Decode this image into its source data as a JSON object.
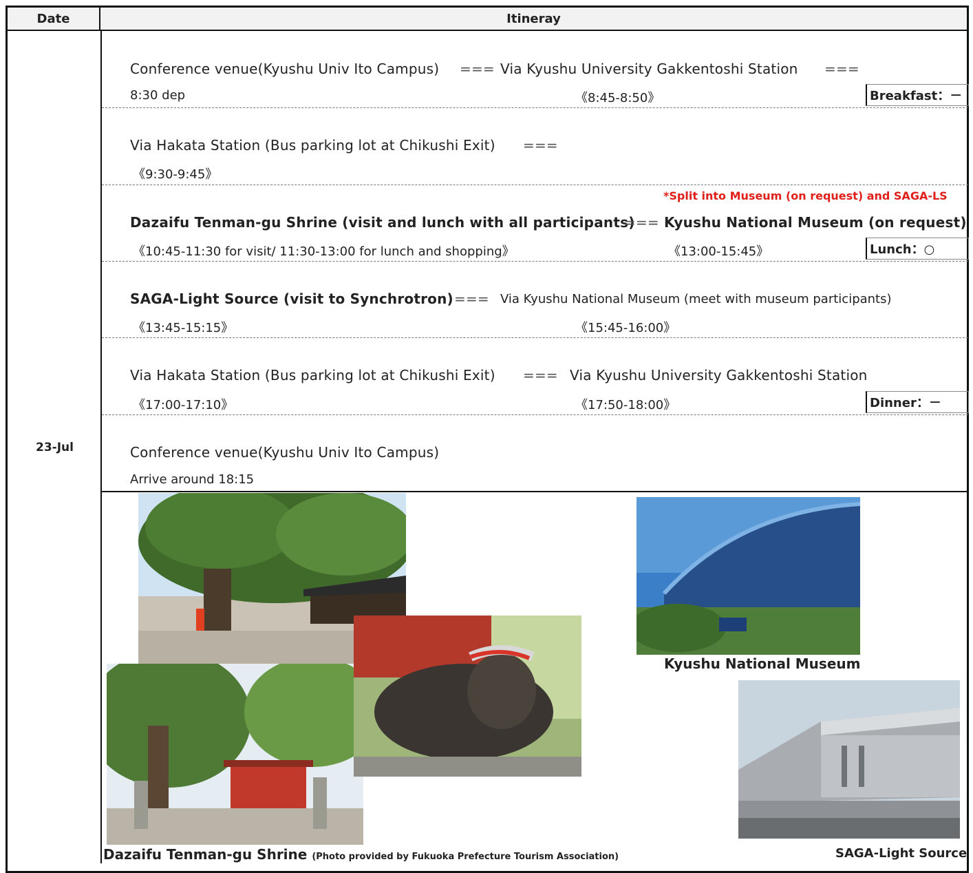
{
  "header": {
    "date_label": "Date",
    "itinerary_label": "Itineray"
  },
  "date": "23-Jul",
  "rows": [
    {
      "line1a": "Conference venue(Kyushu Univ Ito Campus)",
      "sep1": "===",
      "line1b": "Via Kyushu University Gakkentoshi Station",
      "sep2": "===",
      "time_a": "8:30 dep",
      "time_b": "《8:45-8:50》",
      "meal": "Breakfast：－"
    },
    {
      "line1a": "Via Hakata Station (Bus parking lot at Chikushi Exit)",
      "sep1": "===",
      "time_a": "《9:30-9:45》"
    },
    {
      "note": "*Split into Museum (on request) and SAGA-LS",
      "line1a": "Dazaifu Tenman-gu Shrine (visit and lunch with all participants)",
      "sep1": "===",
      "line1b": "Kyushu National Museum (on request)",
      "time_a": "《10:45-11:30 for visit/ 11:30-13:00 for lunch and shopping》",
      "time_b": "《13:00-15:45》",
      "meal": "Lunch：○"
    },
    {
      "line1a": "SAGA-Light Source (visit to Synchrotron)",
      "sep1": "===",
      "line1b": "Via Kyushu National Museum (meet with museum participants)",
      "time_a": "《13:45-15:15》",
      "time_b": "《15:45-16:00》"
    },
    {
      "line1a": "Via Hakata Station (Bus parking lot at Chikushi Exit)",
      "sep1": "===",
      "line1b": "Via Kyushu University Gakkentoshi Station",
      "time_a": "《17:00-17:10》",
      "time_b": "《17:50-18:00》",
      "meal": "Dinner：－"
    },
    {
      "line1a": "Conference venue(Kyushu Univ Ito Campus)",
      "time_a": "Arrive around 18:15"
    }
  ],
  "captions": {
    "dazaifu": "Dazaifu Tenman-gu Shrine",
    "dazaifu_credit": "(Photo provided by Fukuoka Prefecture Tourism Association)",
    "museum": "Kyushu National Museum",
    "saga": "SAGA-Light Source"
  }
}
